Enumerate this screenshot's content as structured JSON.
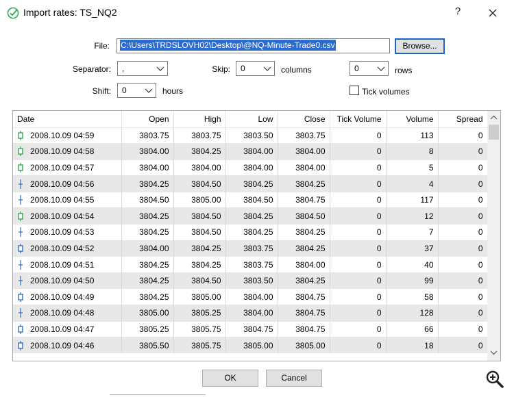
{
  "window": {
    "title": "Import rates: TS_NQ2",
    "help_label": "?",
    "icon": "import-check-icon"
  },
  "form": {
    "file_label": "File:",
    "file_value": "C:\\Users\\TRDSLOVH02\\Desktop\\@NQ-Minute-Trade0.csv",
    "browse_label": "Browse...",
    "separator_label": "Separator:",
    "separator_value": ",",
    "skip_label": "Skip:",
    "skip_columns_value": "0",
    "columns_label": "columns",
    "skip_rows_value": "0",
    "rows_label": "rows",
    "shift_label": "Shift:",
    "shift_value": "0",
    "hours_label": "hours",
    "tick_volumes_label": "Tick volumes",
    "tick_volumes_checked": false
  },
  "table": {
    "columns": [
      "Date",
      "Open",
      "High",
      "Low",
      "Close",
      "Tick Volume",
      "Volume",
      "Spread"
    ],
    "rows": [
      {
        "icon": "green",
        "date": "2008.10.09 04:59",
        "open": "3803.75",
        "high": "3803.75",
        "low": "3803.50",
        "close": "3803.75",
        "tick": "0",
        "vol": "113",
        "spread": "0"
      },
      {
        "icon": "green",
        "date": "2008.10.09 04:58",
        "open": "3804.00",
        "high": "3804.25",
        "low": "3804.00",
        "close": "3804.00",
        "tick": "0",
        "vol": "8",
        "spread": "0"
      },
      {
        "icon": "green",
        "date": "2008.10.09 04:57",
        "open": "3804.00",
        "high": "3804.00",
        "low": "3804.00",
        "close": "3804.00",
        "tick": "0",
        "vol": "5",
        "spread": "0"
      },
      {
        "icon": "cross",
        "date": "2008.10.09 04:56",
        "open": "3804.25",
        "high": "3804.50",
        "low": "3804.25",
        "close": "3804.25",
        "tick": "0",
        "vol": "4",
        "spread": "0"
      },
      {
        "icon": "cross",
        "date": "2008.10.09 04:55",
        "open": "3804.50",
        "high": "3805.00",
        "low": "3804.50",
        "close": "3804.75",
        "tick": "0",
        "vol": "117",
        "spread": "0"
      },
      {
        "icon": "green",
        "date": "2008.10.09 04:54",
        "open": "3804.25",
        "high": "3804.50",
        "low": "3804.25",
        "close": "3804.50",
        "tick": "0",
        "vol": "12",
        "spread": "0"
      },
      {
        "icon": "cross",
        "date": "2008.10.09 04:53",
        "open": "3804.25",
        "high": "3804.50",
        "low": "3804.25",
        "close": "3804.25",
        "tick": "0",
        "vol": "7",
        "spread": "0"
      },
      {
        "icon": "blue",
        "date": "2008.10.09 04:52",
        "open": "3804.00",
        "high": "3804.25",
        "low": "3803.75",
        "close": "3804.25",
        "tick": "0",
        "vol": "37",
        "spread": "0"
      },
      {
        "icon": "cross",
        "date": "2008.10.09 04:51",
        "open": "3804.25",
        "high": "3804.25",
        "low": "3803.75",
        "close": "3804.00",
        "tick": "0",
        "vol": "40",
        "spread": "0"
      },
      {
        "icon": "cross",
        "date": "2008.10.09 04:50",
        "open": "3804.25",
        "high": "3804.50",
        "low": "3803.50",
        "close": "3804.25",
        "tick": "0",
        "vol": "99",
        "spread": "0"
      },
      {
        "icon": "blue",
        "date": "2008.10.09 04:49",
        "open": "3804.25",
        "high": "3805.00",
        "low": "3804.00",
        "close": "3804.75",
        "tick": "0",
        "vol": "58",
        "spread": "0"
      },
      {
        "icon": "cross",
        "date": "2008.10.09 04:48",
        "open": "3805.00",
        "high": "3805.25",
        "low": "3804.00",
        "close": "3804.75",
        "tick": "0",
        "vol": "128",
        "spread": "0"
      },
      {
        "icon": "blue",
        "date": "2008.10.09 04:47",
        "open": "3805.25",
        "high": "3805.75",
        "low": "3804.75",
        "close": "3804.75",
        "tick": "0",
        "vol": "66",
        "spread": "0"
      },
      {
        "icon": "blue",
        "date": "2008.10.09 04:46",
        "open": "3805.50",
        "high": "3805.75",
        "low": "3805.00",
        "close": "3805.00",
        "tick": "0",
        "vol": "18",
        "spread": "0"
      }
    ]
  },
  "buttons": {
    "ok_label": "OK",
    "cancel_label": "Cancel"
  },
  "colors": {
    "selection": "#2c6ccf",
    "candle_green": "#2fa84f",
    "candle_blue": "#2f6fbd",
    "row_alt": "#e8e8e8"
  }
}
